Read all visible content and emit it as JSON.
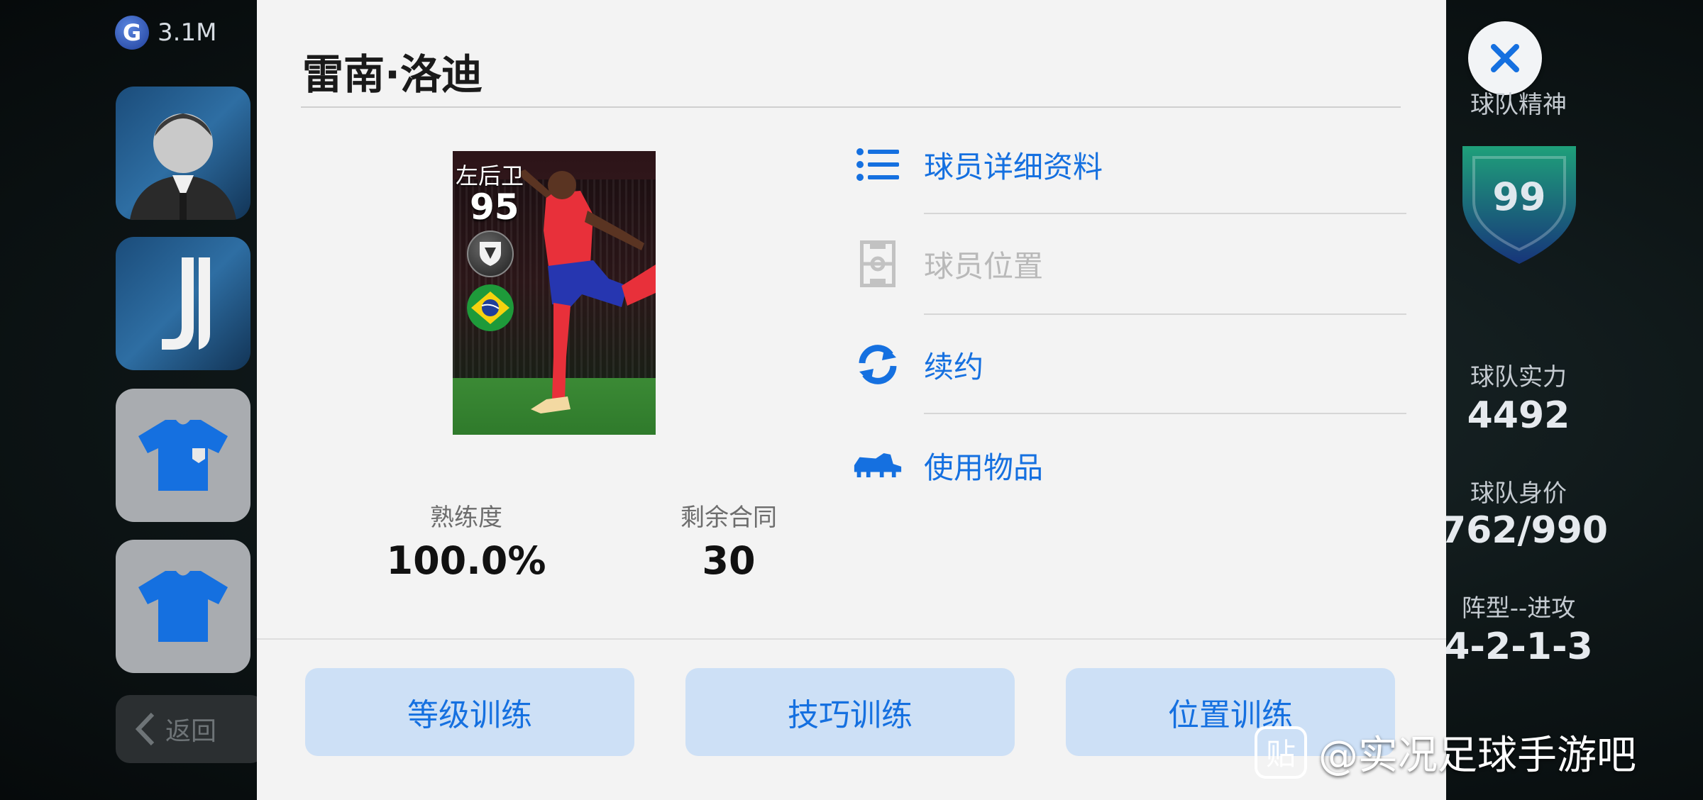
{
  "top_bar": {
    "currency_icon": "G",
    "currency_value": "3.1M"
  },
  "side_nav": {
    "manager_icon": "manager-portrait-icon",
    "club_icon": "club-logo-icon",
    "kit_home_icon": "jersey-icon",
    "kit_away_icon": "jersey-icon",
    "back_label": "返回"
  },
  "modal": {
    "title": "雷南·洛迪",
    "card": {
      "position": "左后卫",
      "rating": "95",
      "nationality": "brazil-flag-icon"
    },
    "proficiency": {
      "label": "熟练度",
      "value": "100.0%"
    },
    "contract": {
      "label": "剩余合同",
      "value": "30"
    },
    "menu": [
      {
        "label": "球员详细资料",
        "icon": "list-icon",
        "enabled": true
      },
      {
        "label": "球员位置",
        "icon": "pitch-icon",
        "enabled": false
      },
      {
        "label": "续约",
        "icon": "refresh-icon",
        "enabled": true
      },
      {
        "label": "使用物品",
        "icon": "boot-icon",
        "enabled": true
      }
    ],
    "buttons": {
      "level_training": "等级训练",
      "skill_training": "技巧训练",
      "position_training": "位置训练"
    }
  },
  "team_panel": {
    "spirit_label": "球队精神",
    "spirit_value": "99",
    "strength_label": "球队实力",
    "strength_value": "4492",
    "value_label": "球队身价",
    "value_value": "762/990",
    "formation_label": "阵型--进攻",
    "formation_value": "4-2-1-3"
  },
  "watermark": {
    "icon": "贴",
    "text": "@实况足球手游吧"
  },
  "colors": {
    "accent": "#1570e0",
    "button_bg": "#cde0f6",
    "modal_bg": "#f3f3f3",
    "disabled": "#b9b9b9"
  }
}
